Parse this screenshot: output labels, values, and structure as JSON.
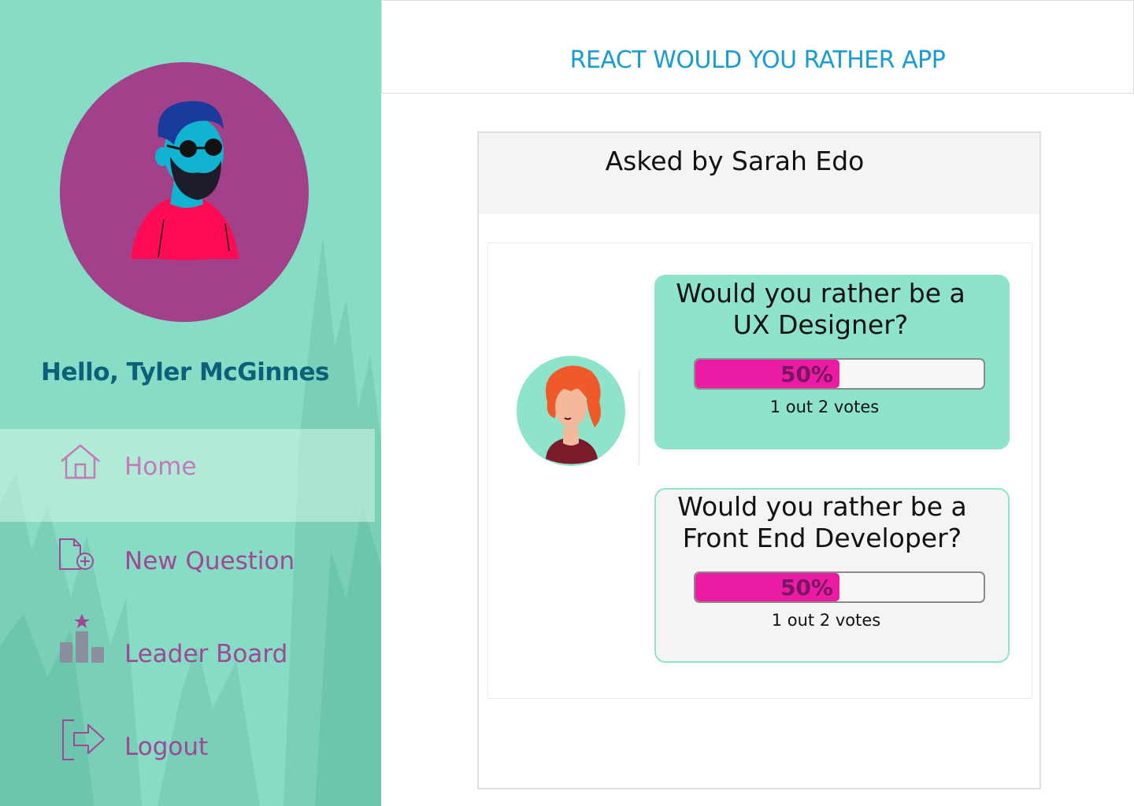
{
  "app": {
    "title": "REACT WOULD YOU RATHER APP"
  },
  "user": {
    "greeting": "Hello, Tyler McGinnes",
    "avatar_icon": "bearded-man-avatar-icon"
  },
  "sidebar": {
    "items": [
      {
        "label": "Home",
        "icon": "home-icon",
        "active": true
      },
      {
        "label": "New Question",
        "icon": "add-document-icon",
        "active": false
      },
      {
        "label": "Leader Board",
        "icon": "leaderboard-icon",
        "active": false
      },
      {
        "label": "Logout",
        "icon": "logout-icon",
        "active": false
      }
    ]
  },
  "question": {
    "asked_by": "Asked by Sarah Edo",
    "author_avatar_icon": "red-haired-woman-avatar-icon",
    "options": [
      {
        "line1": "Would you rather be a",
        "line2": "UX Designer?",
        "percent_label": "50%",
        "percent": 50,
        "votes": "1 out 2 votes",
        "chosen": true
      },
      {
        "line1": "Would you rather be a",
        "line2": "Front End Developer?",
        "percent_label": "50%",
        "percent": 50,
        "votes": "1 out 2 votes",
        "chosen": false
      }
    ]
  },
  "colors": {
    "sidebar_bg": "#86dcc4",
    "accent_magenta": "#ec1ba3",
    "nav_text": "#a04796",
    "title_blue": "#1a9bd1",
    "greeting_blue": "#0e5f78"
  }
}
